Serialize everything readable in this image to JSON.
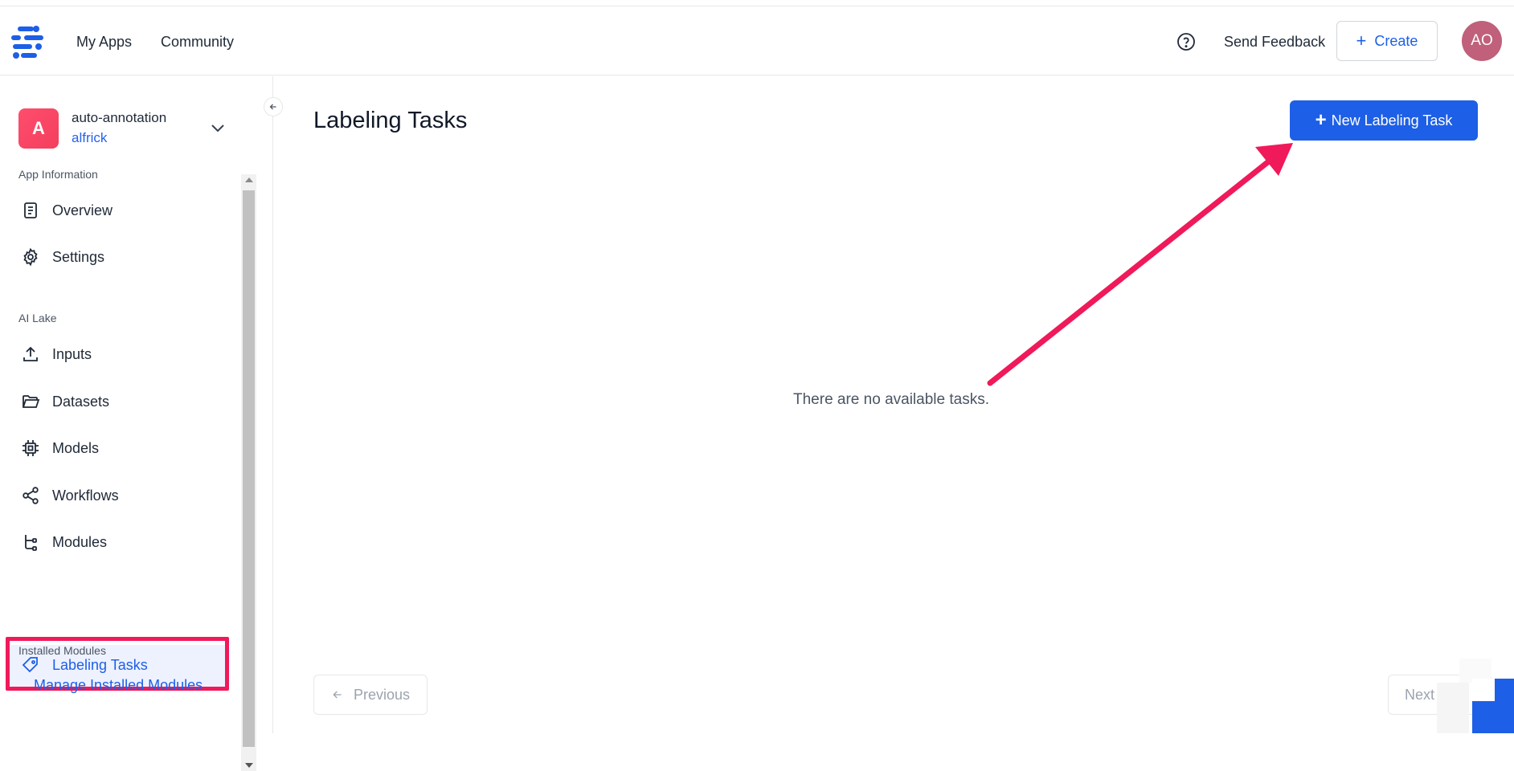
{
  "header": {
    "nav": [
      {
        "label": "My Apps"
      },
      {
        "label": "Community"
      }
    ],
    "send_feedback": "Send Feedback",
    "create_label": "Create",
    "avatar_initials": "AO"
  },
  "sidebar": {
    "app": {
      "icon_letter": "A",
      "name": "auto-annotation",
      "owner": "alfrick"
    },
    "sections": {
      "app_information": "App Information",
      "ai_lake": "AI Lake",
      "installed_modules": "Installed Modules"
    },
    "items": [
      {
        "label": "Overview",
        "icon": "document-icon"
      },
      {
        "label": "Settings",
        "icon": "gear-icon"
      },
      {
        "label": "Inputs",
        "icon": "upload-icon"
      },
      {
        "label": "Datasets",
        "icon": "folder-icon"
      },
      {
        "label": "Models",
        "icon": "chip-icon"
      },
      {
        "label": "Workflows",
        "icon": "share-nodes-icon"
      },
      {
        "label": "Modules",
        "icon": "module-tree-icon"
      },
      {
        "label": "Labeling Tasks",
        "icon": "tag-icon",
        "active": true
      }
    ],
    "manage_link": "Manage Installed Modules"
  },
  "main": {
    "title": "Labeling Tasks",
    "new_task_label": "New Labeling Task",
    "empty_message": "There are no available tasks.",
    "previous_label": "Previous",
    "next_label": "Next"
  },
  "colors": {
    "accent": "#1d5fe6",
    "annotation": "#f0195a",
    "avatar": "#c0607a"
  }
}
